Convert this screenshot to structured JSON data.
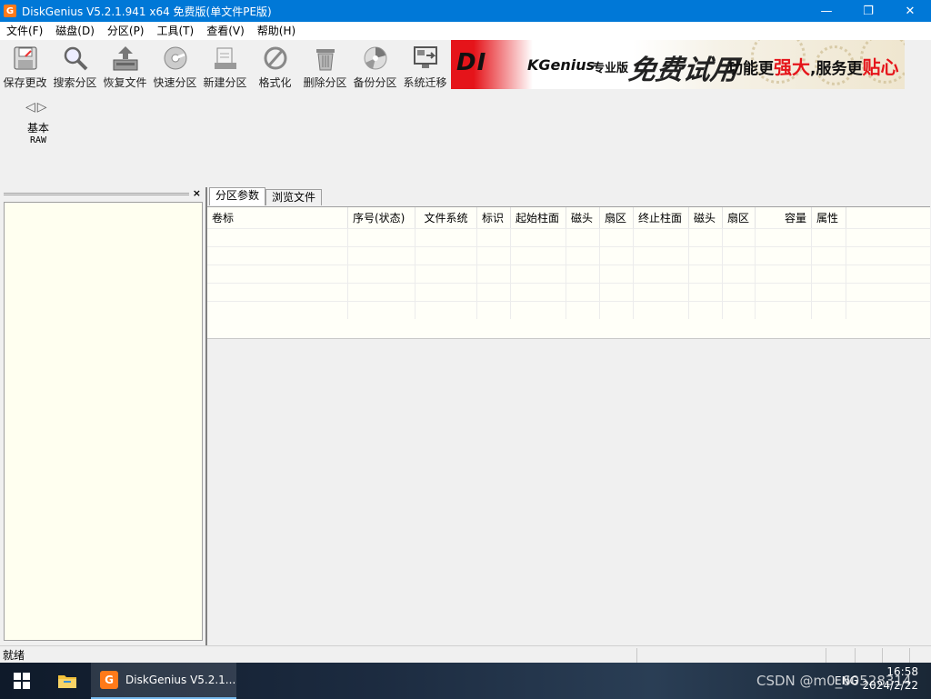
{
  "window": {
    "title": "DiskGenius V5.2.1.941 x64 免费版(单文件PE版)",
    "app_icon_letter": "G",
    "minimize": "—",
    "maximize": "❐",
    "close": "✕"
  },
  "menu": [
    "文件(F)",
    "磁盘(D)",
    "分区(P)",
    "工具(T)",
    "查看(V)",
    "帮助(H)"
  ],
  "toolbar": [
    {
      "label": "保存更改",
      "icon": "save-icon"
    },
    {
      "label": "搜索分区",
      "icon": "search-partition-icon"
    },
    {
      "label": "恢复文件",
      "icon": "recover-files-icon"
    },
    {
      "label": "快速分区",
      "icon": "quick-partition-icon"
    },
    {
      "label": "新建分区",
      "icon": "new-partition-icon"
    },
    {
      "label": "格式化",
      "icon": "format-icon"
    },
    {
      "label": "删除分区",
      "icon": "delete-partition-icon"
    },
    {
      "label": "备份分区",
      "icon": "backup-partition-icon"
    },
    {
      "label": "系统迁移",
      "icon": "system-migration-icon"
    }
  ],
  "banner": {
    "logo": "DI",
    "logo2": "KGenius",
    "edition": "专业版",
    "free_trial": "免费试用",
    "slogan_a": "功能更",
    "slogan_b": "强大",
    "slogan_c": ",服务更",
    "slogan_d": "贴心"
  },
  "disk": {
    "nav_prev": "◁",
    "nav_next": "▷",
    "type": "基本",
    "fs": "RAW"
  },
  "left_panel": {
    "close": "×"
  },
  "tabs": [
    {
      "label": "分区参数",
      "active": true
    },
    {
      "label": "浏览文件",
      "active": false
    }
  ],
  "table": {
    "columns": [
      "卷标",
      "序号(状态)",
      "文件系统",
      "标识",
      "起始柱面",
      "磁头",
      "扇区",
      "终止柱面",
      "磁头",
      "扇区",
      "容量",
      "属性"
    ],
    "empty_rows": 5
  },
  "status": {
    "text": "就绪"
  },
  "taskbar": {
    "task_label": "DiskGenius V5.2.1...",
    "task_icon_letter": "G",
    "lang": "ENG",
    "time": "16:58",
    "date": "2024/2/22",
    "watermark": "CSDN @m0_60528314"
  }
}
